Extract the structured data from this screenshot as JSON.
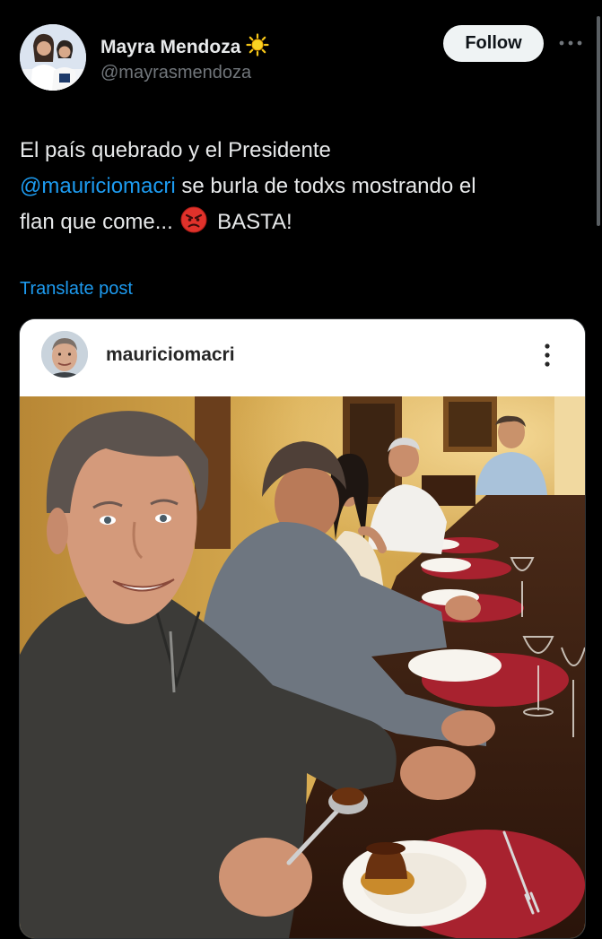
{
  "post": {
    "author": {
      "display_name": "Mayra Mendoza",
      "handle": "@mayrasmendoza",
      "badge_icon": "sun-icon"
    },
    "follow_label": "Follow",
    "more_icon": "more-horizontal-icon",
    "text": {
      "line1": "El país quebrado y el Presidente",
      "mention": "@mauriciomacri",
      "line2_rest": " se burla de todxs mostrando el",
      "line3_start": "flan que come...",
      "emoji_icon": "angry-face-icon",
      "line3_end": " BASTA!"
    },
    "translate_label": "Translate post"
  },
  "embedded": {
    "username": "mauriciomacri",
    "more_icon": "more-vertical-icon"
  },
  "colors": {
    "background": "#000000",
    "text": "#e7e9ea",
    "secondary_text": "#71767b",
    "link": "#1d9bf0",
    "follow_bg": "#eff3f4"
  }
}
